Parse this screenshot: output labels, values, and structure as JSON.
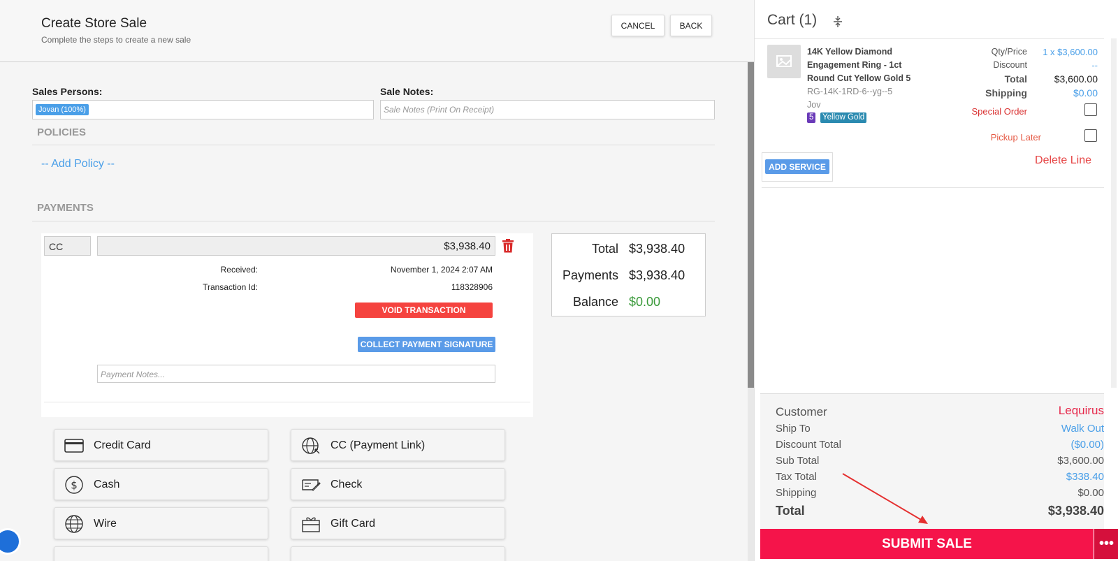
{
  "header": {
    "title": "Create Store Sale",
    "subtitle": "Complete the steps to create a new sale",
    "cancel_label": "CANCEL",
    "back_label": "BACK"
  },
  "sale_form": {
    "salespersons_label": "Sales Persons:",
    "salesperson_tag": "Jovan (100%)",
    "sale_notes_label": "Sale Notes:",
    "sale_notes_placeholder": "Sale Notes (Print On Receipt)"
  },
  "policies": {
    "title": "POLICIES",
    "add_policy_label": "-- Add Policy --"
  },
  "payments": {
    "title": "PAYMENTS",
    "entry": {
      "method": "CC",
      "amount": "$3,938.40",
      "received_label": "Received:",
      "received_value": "November 1, 2024 2:07 AM",
      "transaction_label": "Transaction Id:",
      "transaction_value": "118328906",
      "void_label": "VOID TRANSACTION",
      "collect_signature_label": "COLLECT PAYMENT SIGNATURE",
      "notes_placeholder": "Payment Notes..."
    },
    "totals": {
      "total_label": "Total",
      "total_value": "$3,938.40",
      "payments_label": "Payments",
      "payments_value": "$3,938.40",
      "balance_label": "Balance",
      "balance_value": "$0.00"
    },
    "methods": [
      {
        "label": "Credit Card",
        "icon": "credit-card-icon"
      },
      {
        "label": "CC (Payment Link)",
        "icon": "globe-link-icon"
      },
      {
        "label": "Cash",
        "icon": "dollar-circle-icon"
      },
      {
        "label": "Check",
        "icon": "check-icon"
      },
      {
        "label": "Wire",
        "icon": "globe-icon"
      },
      {
        "label": "Gift Card",
        "icon": "gift-card-icon"
      }
    ]
  },
  "cart": {
    "title": "Cart (1)",
    "item": {
      "name_line1": "14K Yellow Diamond",
      "name_line2": "Engagement Ring - 1ct",
      "name_line3": "Round Cut Yellow Gold 5",
      "sku": "RG-14K-1RD-6--yg--5",
      "salesperson": "Jov",
      "size_badge": "5",
      "metal_badge": "Yellow Gold",
      "qty_price_label": "Qty/Price",
      "qty_price_value": "1 x $3,600.00",
      "discount_label": "Discount",
      "discount_value": "--",
      "total_label": "Total",
      "total_value": "$3,600.00",
      "shipping_label": "Shipping",
      "shipping_value": "$0.00",
      "special_order_label": "Special Order",
      "pickup_later_label": "Pickup Later",
      "add_service_label": "ADD SERVICE",
      "delete_line_label": "Delete Line"
    },
    "summary": {
      "customer_label": "Customer",
      "customer_value": "Lequirus",
      "ship_to_label": "Ship To",
      "ship_to_value": "Walk Out",
      "discount_total_label": "Discount Total",
      "discount_total_value": "($0.00)",
      "sub_total_label": "Sub Total",
      "sub_total_value": "$3,600.00",
      "tax_total_label": "Tax Total",
      "tax_total_value": "$338.40",
      "shipping_label": "Shipping",
      "shipping_value": "$0.00",
      "total_label": "Total",
      "total_value": "$3,938.40"
    },
    "submit_label": "SUBMIT SALE",
    "more_label": "•••"
  },
  "colors": {
    "accent_blue": "#4a9fe8",
    "danger_red": "#f5433f",
    "submit_red": "#f5144a",
    "success_green": "#3a9a3a"
  }
}
